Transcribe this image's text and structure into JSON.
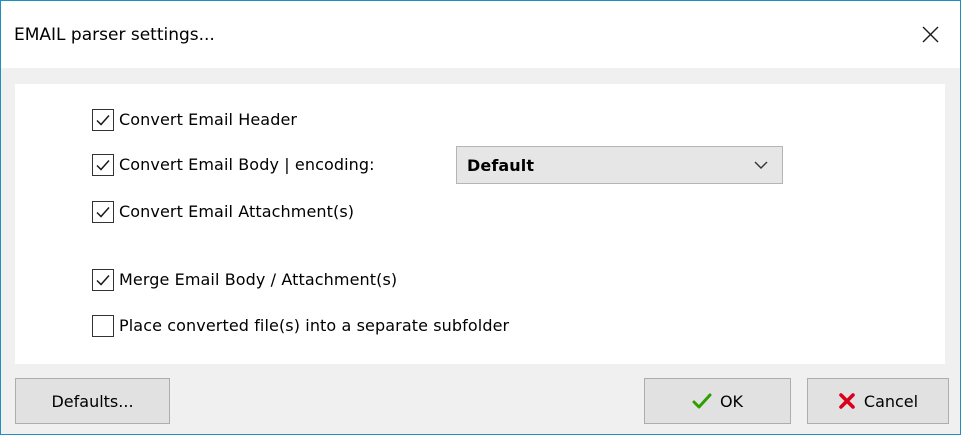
{
  "window": {
    "title": "EMAIL parser settings...",
    "close_icon": "close-icon"
  },
  "options": [
    {
      "label": "Convert Email Header",
      "checked": true
    },
    {
      "label": "Convert Email Body | encoding:",
      "checked": true
    },
    {
      "label": "Convert Email Attachment(s)",
      "checked": true
    },
    {
      "label": "Merge Email Body / Attachment(s)",
      "checked": true
    },
    {
      "label": "Place converted file(s) into a separate subfolder",
      "checked": false
    }
  ],
  "encoding": {
    "selected": "Default",
    "icon": "chevron-down-icon"
  },
  "buttons": {
    "defaults_label": "Defaults...",
    "ok_label": "OK",
    "ok_icon": "checkmark-icon",
    "ok_icon_color": "#2f9e00",
    "cancel_label": "Cancel",
    "cancel_icon": "x-mark-icon",
    "cancel_icon_color": "#d9001b"
  },
  "colors": {
    "window_border": "#1f8fbf",
    "dialog_background": "#f0f0f0",
    "button_background": "#e1e1e1"
  }
}
